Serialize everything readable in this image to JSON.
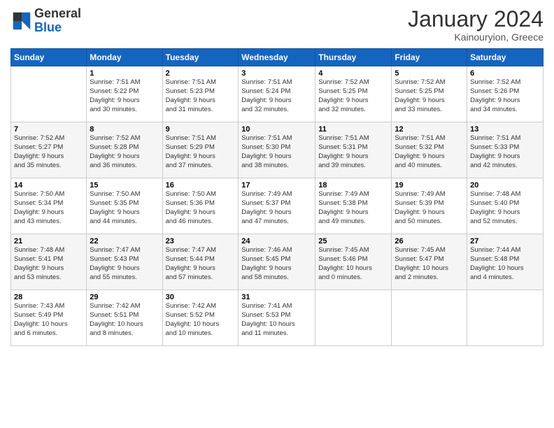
{
  "header": {
    "logo_general": "General",
    "logo_blue": "Blue",
    "title": "January 2024",
    "subtitle": "Kainouryion, Greece"
  },
  "columns": [
    "Sunday",
    "Monday",
    "Tuesday",
    "Wednesday",
    "Thursday",
    "Friday",
    "Saturday"
  ],
  "weeks": [
    [
      {
        "day": "",
        "info": ""
      },
      {
        "day": "1",
        "info": "Sunrise: 7:51 AM\nSunset: 5:22 PM\nDaylight: 9 hours\nand 30 minutes."
      },
      {
        "day": "2",
        "info": "Sunrise: 7:51 AM\nSunset: 5:23 PM\nDaylight: 9 hours\nand 31 minutes."
      },
      {
        "day": "3",
        "info": "Sunrise: 7:51 AM\nSunset: 5:24 PM\nDaylight: 9 hours\nand 32 minutes."
      },
      {
        "day": "4",
        "info": "Sunrise: 7:52 AM\nSunset: 5:25 PM\nDaylight: 9 hours\nand 32 minutes."
      },
      {
        "day": "5",
        "info": "Sunrise: 7:52 AM\nSunset: 5:25 PM\nDaylight: 9 hours\nand 33 minutes."
      },
      {
        "day": "6",
        "info": "Sunrise: 7:52 AM\nSunset: 5:26 PM\nDaylight: 9 hours\nand 34 minutes."
      }
    ],
    [
      {
        "day": "7",
        "info": "Sunrise: 7:52 AM\nSunset: 5:27 PM\nDaylight: 9 hours\nand 35 minutes."
      },
      {
        "day": "8",
        "info": "Sunrise: 7:52 AM\nSunset: 5:28 PM\nDaylight: 9 hours\nand 36 minutes."
      },
      {
        "day": "9",
        "info": "Sunrise: 7:51 AM\nSunset: 5:29 PM\nDaylight: 9 hours\nand 37 minutes."
      },
      {
        "day": "10",
        "info": "Sunrise: 7:51 AM\nSunset: 5:30 PM\nDaylight: 9 hours\nand 38 minutes."
      },
      {
        "day": "11",
        "info": "Sunrise: 7:51 AM\nSunset: 5:31 PM\nDaylight: 9 hours\nand 39 minutes."
      },
      {
        "day": "12",
        "info": "Sunrise: 7:51 AM\nSunset: 5:32 PM\nDaylight: 9 hours\nand 40 minutes."
      },
      {
        "day": "13",
        "info": "Sunrise: 7:51 AM\nSunset: 5:33 PM\nDaylight: 9 hours\nand 42 minutes."
      }
    ],
    [
      {
        "day": "14",
        "info": "Sunrise: 7:50 AM\nSunset: 5:34 PM\nDaylight: 9 hours\nand 43 minutes."
      },
      {
        "day": "15",
        "info": "Sunrise: 7:50 AM\nSunset: 5:35 PM\nDaylight: 9 hours\nand 44 minutes."
      },
      {
        "day": "16",
        "info": "Sunrise: 7:50 AM\nSunset: 5:36 PM\nDaylight: 9 hours\nand 46 minutes."
      },
      {
        "day": "17",
        "info": "Sunrise: 7:49 AM\nSunset: 5:37 PM\nDaylight: 9 hours\nand 47 minutes."
      },
      {
        "day": "18",
        "info": "Sunrise: 7:49 AM\nSunset: 5:38 PM\nDaylight: 9 hours\nand 49 minutes."
      },
      {
        "day": "19",
        "info": "Sunrise: 7:49 AM\nSunset: 5:39 PM\nDaylight: 9 hours\nand 50 minutes."
      },
      {
        "day": "20",
        "info": "Sunrise: 7:48 AM\nSunset: 5:40 PM\nDaylight: 9 hours\nand 52 minutes."
      }
    ],
    [
      {
        "day": "21",
        "info": "Sunrise: 7:48 AM\nSunset: 5:41 PM\nDaylight: 9 hours\nand 53 minutes."
      },
      {
        "day": "22",
        "info": "Sunrise: 7:47 AM\nSunset: 5:43 PM\nDaylight: 9 hours\nand 55 minutes."
      },
      {
        "day": "23",
        "info": "Sunrise: 7:47 AM\nSunset: 5:44 PM\nDaylight: 9 hours\nand 57 minutes."
      },
      {
        "day": "24",
        "info": "Sunrise: 7:46 AM\nSunset: 5:45 PM\nDaylight: 9 hours\nand 58 minutes."
      },
      {
        "day": "25",
        "info": "Sunrise: 7:45 AM\nSunset: 5:46 PM\nDaylight: 10 hours\nand 0 minutes."
      },
      {
        "day": "26",
        "info": "Sunrise: 7:45 AM\nSunset: 5:47 PM\nDaylight: 10 hours\nand 2 minutes."
      },
      {
        "day": "27",
        "info": "Sunrise: 7:44 AM\nSunset: 5:48 PM\nDaylight: 10 hours\nand 4 minutes."
      }
    ],
    [
      {
        "day": "28",
        "info": "Sunrise: 7:43 AM\nSunset: 5:49 PM\nDaylight: 10 hours\nand 6 minutes."
      },
      {
        "day": "29",
        "info": "Sunrise: 7:42 AM\nSunset: 5:51 PM\nDaylight: 10 hours\nand 8 minutes."
      },
      {
        "day": "30",
        "info": "Sunrise: 7:42 AM\nSunset: 5:52 PM\nDaylight: 10 hours\nand 10 minutes."
      },
      {
        "day": "31",
        "info": "Sunrise: 7:41 AM\nSunset: 5:53 PM\nDaylight: 10 hours\nand 11 minutes."
      },
      {
        "day": "",
        "info": ""
      },
      {
        "day": "",
        "info": ""
      },
      {
        "day": "",
        "info": ""
      }
    ]
  ]
}
